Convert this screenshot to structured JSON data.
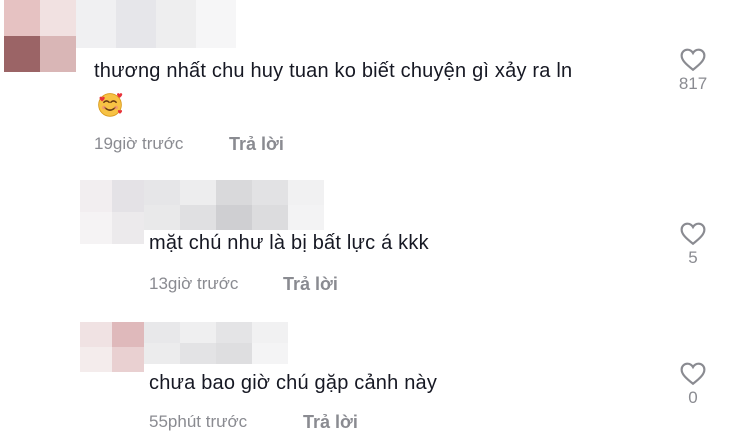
{
  "colors": {
    "text": "#161823",
    "muted": "#8a8b91",
    "background": "#ffffff"
  },
  "icons": {
    "like": "heart-outline-icon",
    "reaction_emoji": "smiling-face-with-hearts-emoji"
  },
  "comments": [
    {
      "text": "thương nhất chu huy tuan ko biết chuyện gì xảy ra ln",
      "time": "19giờ trước",
      "reply_label": "Trả lời",
      "likes": "817",
      "has_emoji": true
    },
    {
      "text": "mặt chú như là bị bất lực á kkk",
      "time": "13giờ trước",
      "reply_label": "Trả lời",
      "likes": "5"
    },
    {
      "text": "chưa bao giờ chú gặp cảnh này",
      "time": "55phút trước",
      "reply_label": "Trả lời",
      "likes": "0"
    }
  ]
}
